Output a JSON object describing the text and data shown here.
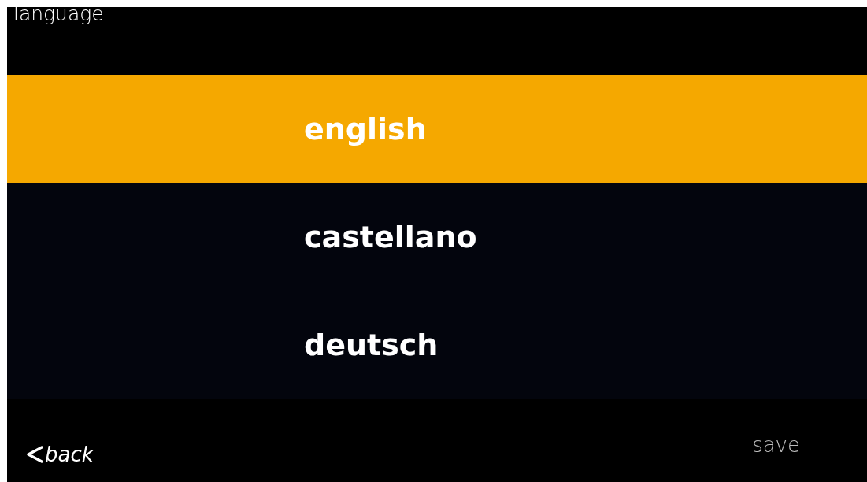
{
  "header": {
    "title": "language"
  },
  "languages": [
    {
      "label": "english",
      "selected": true
    },
    {
      "label": "castellano",
      "selected": false
    },
    {
      "label": "deutsch",
      "selected": false
    }
  ],
  "footer": {
    "back": {
      "label": "back"
    },
    "save": {
      "label": "save",
      "disabled": true
    }
  }
}
